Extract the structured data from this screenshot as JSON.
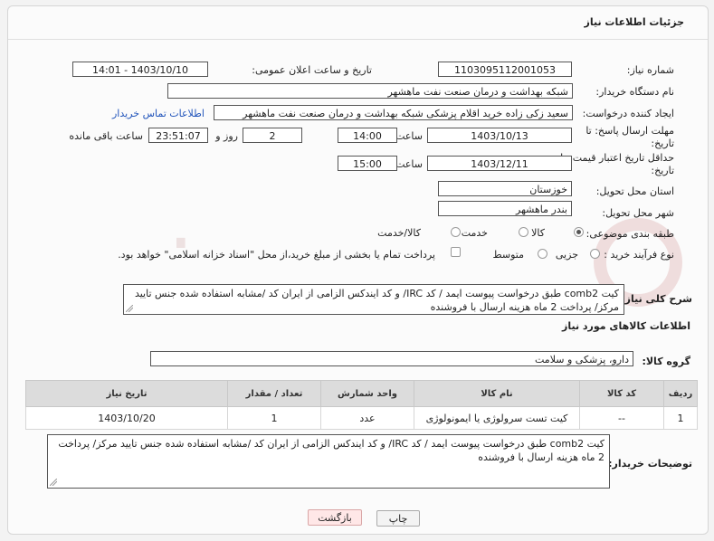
{
  "title": "جزئیات اطلاعات نیاز",
  "need_number": {
    "label": "شماره نیاز:",
    "value": "1103095112001053"
  },
  "announce": {
    "label": "تاریخ و ساعت اعلان عمومی:",
    "value": "1403/10/10 - 14:01"
  },
  "buyer_org": {
    "label": "نام دستگاه خریدار:",
    "value": "شبکه بهداشت و درمان صنعت نفت ماهشهر"
  },
  "creator": {
    "label": "ایجاد کننده درخواست:",
    "value": "سعید زکی زاده خرید اقلام پزشکی شبکه بهداشت و درمان صنعت نفت ماهشهر",
    "contact_link": "اطلاعات تماس خریدار"
  },
  "deadline": {
    "label": "مهلت ارسال پاسخ: تا تاریخ:",
    "date": "1403/10/13",
    "time_label": "ساعت",
    "time": "14:00",
    "days": "2",
    "days_label": "روز و",
    "remaining": "23:51:07",
    "remaining_label": "ساعت باقی مانده"
  },
  "validity": {
    "label": "حداقل تاریخ اعتبار قیمت: تا تاریخ:",
    "date": "1403/12/11",
    "time_label": "ساعت",
    "time": "15:00"
  },
  "province": {
    "label": "استان محل تحویل:",
    "value": "خوزستان"
  },
  "city": {
    "label": "شهر محل تحویل:",
    "value": "بندر ماهشهر"
  },
  "category": {
    "label": "طبقه بندی موضوعی:",
    "options": [
      "کالا",
      "خدمت",
      "کالا/خدمت"
    ],
    "selected": "کالا"
  },
  "process": {
    "label": "نوع فرآیند خرید :",
    "options": [
      "جزیی",
      "متوسط"
    ],
    "note": "پرداخت تمام یا بخشی از مبلغ خرید،از محل \"اسناد خزانه اسلامی\" خواهد بود."
  },
  "description": {
    "label": "شرح کلی نیاز:",
    "value": "کیت comb2  طبق درخواست پیوست ایمد / کد IRC/ و کد ایندکس الزامی از ایران کد /مشابه استفاده شده جنس تایید مرکز/ پرداخت 2 ماه هزینه ارسال با فروشنده"
  },
  "goods_info_title": "اطلاعات کالاهای مورد نیاز",
  "goods_group": {
    "label": "گروه کالا:",
    "value": "دارو، پزشکی و سلامت"
  },
  "table": {
    "headers": [
      "ردیف",
      "کد کالا",
      "نام کالا",
      "واحد شمارش",
      "تعداد / مقدار",
      "تاریخ نیاز"
    ],
    "rows": [
      [
        "1",
        "--",
        "کیت تست سرولوژی یا ایمونولوژی",
        "عدد",
        "1",
        "1403/10/20"
      ]
    ]
  },
  "buyer_notes": {
    "label": "توضیحات خریدار:",
    "value": "کیت comb2  طبق درخواست پیوست ایمد / کد IRC/ و کد ایندکس الزامی از ایران کد /مشابه استفاده شده جنس تایید مرکز/ پرداخت 2 ماه هزینه ارسال با فروشنده"
  },
  "buttons": {
    "print": "چاپ",
    "back": "بازگشت"
  },
  "watermark_text": "AriaTender.neT",
  "colors": {
    "link": "#2255bb",
    "table_header": "#dcdcdc",
    "back_button": "#ffe7e7"
  }
}
